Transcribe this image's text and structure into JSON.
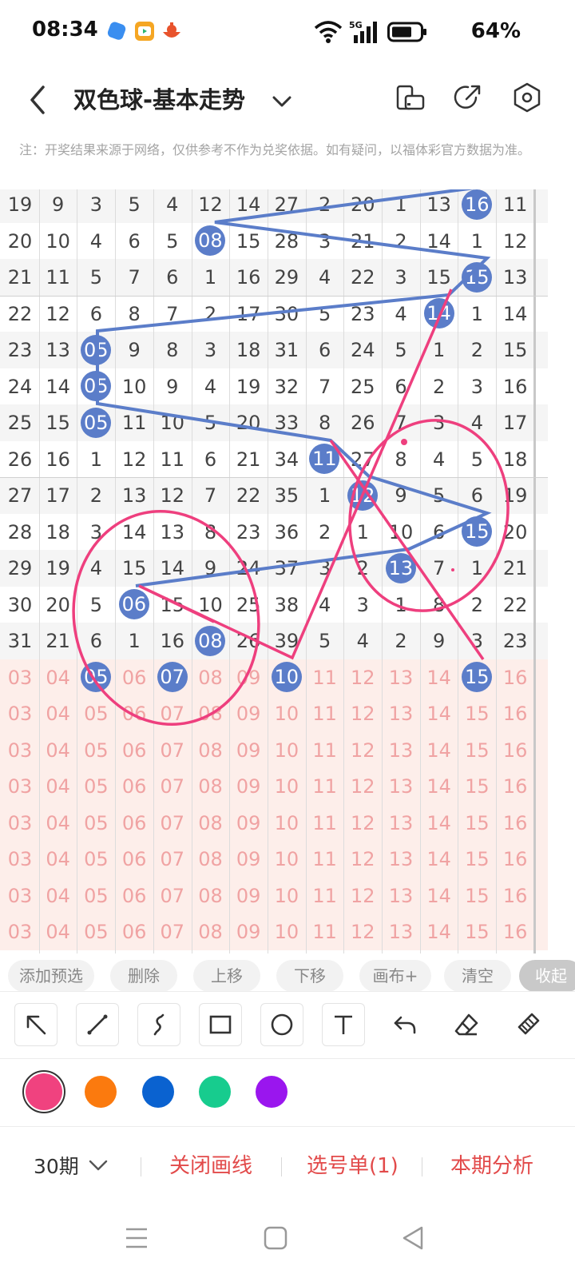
{
  "status_bar": {
    "time": "08:34",
    "battery": "64%",
    "network": "5G"
  },
  "header": {
    "title": "双色球-基本走势"
  },
  "notice": "注：开奖结果来源于网络，仅供参考不作为兑奖依据。如有疑问，以福体彩官方数据为准。",
  "chart": {
    "rows": [
      {
        "cells": [
          "19",
          "9",
          "3",
          "5",
          "4",
          "12",
          "14",
          "27",
          "2",
          "20",
          "1",
          "13",
          "16",
          "11"
        ],
        "balls": [
          12
        ],
        "shade": true
      },
      {
        "cells": [
          "20",
          "10",
          "4",
          "6",
          "5",
          "08",
          "15",
          "28",
          "3",
          "21",
          "2",
          "14",
          "1",
          "12"
        ],
        "balls": [
          5
        ],
        "shade": false
      },
      {
        "cells": [
          "21",
          "11",
          "5",
          "7",
          "6",
          "1",
          "16",
          "29",
          "4",
          "22",
          "3",
          "15",
          "15",
          "13"
        ],
        "balls": [
          12
        ],
        "shade": true
      },
      {
        "cells": [
          "22",
          "12",
          "6",
          "8",
          "7",
          "2",
          "17",
          "30",
          "5",
          "23",
          "4",
          "14",
          "1",
          "14"
        ],
        "balls": [
          11
        ],
        "shade": false
      },
      {
        "cells": [
          "23",
          "13",
          "05",
          "9",
          "8",
          "3",
          "18",
          "31",
          "6",
          "24",
          "5",
          "1",
          "2",
          "15"
        ],
        "balls": [
          2
        ],
        "shade": true
      },
      {
        "cells": [
          "24",
          "14",
          "05",
          "10",
          "9",
          "4",
          "19",
          "32",
          "7",
          "25",
          "6",
          "2",
          "3",
          "16"
        ],
        "balls": [
          2
        ],
        "shade": false
      },
      {
        "cells": [
          "25",
          "15",
          "05",
          "11",
          "10",
          "5",
          "20",
          "33",
          "8",
          "26",
          "7",
          "3",
          "4",
          "17"
        ],
        "balls": [
          2
        ],
        "shade": true
      },
      {
        "cells": [
          "26",
          "16",
          "1",
          "12",
          "11",
          "6",
          "21",
          "34",
          "11",
          "27",
          "8",
          "4",
          "5",
          "18"
        ],
        "balls": [
          8
        ],
        "shade": false
      },
      {
        "cells": [
          "27",
          "17",
          "2",
          "13",
          "12",
          "7",
          "22",
          "35",
          "1",
          "12",
          "9",
          "5",
          "6",
          "19"
        ],
        "balls": [
          9
        ],
        "shade": true
      },
      {
        "cells": [
          "28",
          "18",
          "3",
          "14",
          "13",
          "8",
          "23",
          "36",
          "2",
          "1",
          "10",
          "6",
          "15",
          "20"
        ],
        "balls": [
          12
        ],
        "shade": false
      },
      {
        "cells": [
          "29",
          "19",
          "4",
          "15",
          "14",
          "9",
          "24",
          "37",
          "3",
          "2",
          "13",
          "7",
          "1",
          "21"
        ],
        "balls": [
          10
        ],
        "shade": true
      },
      {
        "cells": [
          "30",
          "20",
          "5",
          "06",
          "15",
          "10",
          "25",
          "38",
          "4",
          "3",
          "1",
          "8",
          "2",
          "22"
        ],
        "balls": [
          3
        ],
        "shade": false
      },
      {
        "cells": [
          "31",
          "21",
          "6",
          "1",
          "16",
          "08",
          "26",
          "39",
          "5",
          "4",
          "2",
          "9",
          "3",
          "23"
        ],
        "balls": [
          5
        ],
        "shade": true
      },
      {
        "cells": [
          "03",
          "04",
          "05",
          "06",
          "07",
          "08",
          "09",
          "10",
          "11",
          "12",
          "13",
          "14",
          "15",
          "16"
        ],
        "balls": [
          2,
          4,
          7,
          12
        ],
        "pred": true
      },
      {
        "cells": [
          "03",
          "04",
          "05",
          "06",
          "07",
          "08",
          "09",
          "10",
          "11",
          "12",
          "13",
          "14",
          "15",
          "16"
        ],
        "balls": [],
        "pred": true
      },
      {
        "cells": [
          "03",
          "04",
          "05",
          "06",
          "07",
          "08",
          "09",
          "10",
          "11",
          "12",
          "13",
          "14",
          "15",
          "16"
        ],
        "balls": [],
        "pred": true
      },
      {
        "cells": [
          "03",
          "04",
          "05",
          "06",
          "07",
          "08",
          "09",
          "10",
          "11",
          "12",
          "13",
          "14",
          "15",
          "16"
        ],
        "balls": [],
        "pred": true
      },
      {
        "cells": [
          "03",
          "04",
          "05",
          "06",
          "07",
          "08",
          "09",
          "10",
          "11",
          "12",
          "13",
          "14",
          "15",
          "16"
        ],
        "balls": [],
        "pred": true
      },
      {
        "cells": [
          "03",
          "04",
          "05",
          "06",
          "07",
          "08",
          "09",
          "10",
          "11",
          "12",
          "13",
          "14",
          "15",
          "16"
        ],
        "balls": [],
        "pred": true
      },
      {
        "cells": [
          "03",
          "04",
          "05",
          "06",
          "07",
          "08",
          "09",
          "10",
          "11",
          "12",
          "13",
          "14",
          "15",
          "16"
        ],
        "balls": [],
        "pred": true
      },
      {
        "cells": [
          "03",
          "04",
          "05",
          "06",
          "07",
          "08",
          "09",
          "10",
          "11",
          "12",
          "13",
          "14",
          "15",
          "16"
        ],
        "balls": [],
        "pred": true
      }
    ],
    "ball_color": "#5b7dc9",
    "pred_text_color": "#f0a3a3"
  },
  "chips": [
    "添加预选",
    "删除",
    "上移",
    "下移",
    "画布+",
    "清空",
    "收起"
  ],
  "tools": [
    "pointer-arrow-icon",
    "line-icon",
    "freehand-icon",
    "rectangle-icon",
    "circle-icon",
    "text-icon",
    "undo-icon",
    "eraser-icon",
    "clear-brush-icon"
  ],
  "colors": [
    "#f0427f",
    "#fb7a0e",
    "#0a62d0",
    "#17cc8e",
    "#9a16ee"
  ],
  "bottom": {
    "period": "30期",
    "close_draw": "关闭画线",
    "ticket": "选号单(1)",
    "analysis": "本期分析"
  }
}
